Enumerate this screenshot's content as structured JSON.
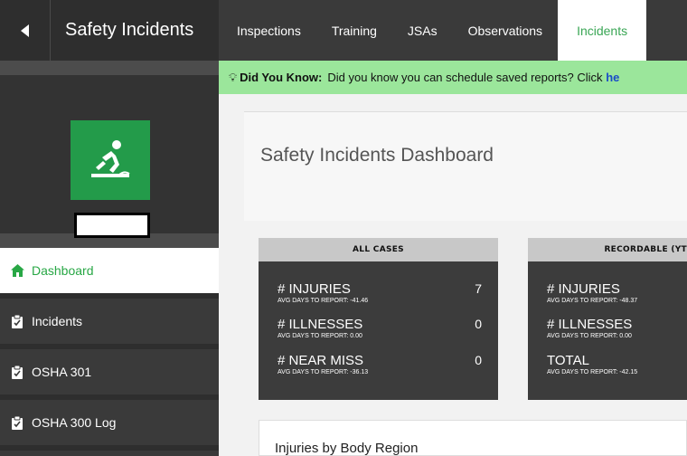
{
  "topbar": {
    "title": "Safety Incidents",
    "tabs": [
      "Inspections",
      "Training",
      "JSAs",
      "Observations",
      "Incidents"
    ],
    "active_tab": "Incidents"
  },
  "sidebar": {
    "items": [
      {
        "label": "Dashboard",
        "icon": "home-icon",
        "active": true
      },
      {
        "label": "Incidents",
        "icon": "clipboard-check-icon"
      },
      {
        "label": "OSHA 301",
        "icon": "clipboard-check-icon"
      },
      {
        "label": "OSHA 300 Log",
        "icon": "clipboard-check-icon"
      }
    ],
    "logo_icon": "slip-fall-icon"
  },
  "banner": {
    "lead": "Did You Know:",
    "text": "Did you know you can schedule saved reports? Click",
    "link": "he"
  },
  "dashboard": {
    "title": "Safety Incidents Dashboard"
  },
  "cards": {
    "all_cases": {
      "header": "ALL CASES",
      "rows": [
        {
          "label": "# INJURIES",
          "sub": "AVG DAYS TO REPORT: -41.46",
          "value": "7"
        },
        {
          "label": "# ILLNESSES",
          "sub": "AVG DAYS TO REPORT: 0.00",
          "value": "0"
        },
        {
          "label": "# NEAR MISS",
          "sub": "AVG DAYS TO REPORT: -36.13",
          "value": "0"
        }
      ]
    },
    "recordable": {
      "header": "RECORDABLE (YT",
      "rows": [
        {
          "label": "# INJURIES",
          "sub": "AVG DAYS TO REPORT: -48.37"
        },
        {
          "label": "# ILLNESSES",
          "sub": "AVG DAYS TO REPORT: 0.00"
        },
        {
          "label": "TOTAL",
          "sub": "AVG DAYS TO REPORT: -42.15"
        }
      ]
    }
  },
  "injuries_panel": {
    "title": "Injuries by Body Region"
  },
  "colors": {
    "brand_green": "#239b4a",
    "active_green": "#28a745",
    "banner_green": "#9be69b",
    "dark": "#3a3a3a"
  }
}
